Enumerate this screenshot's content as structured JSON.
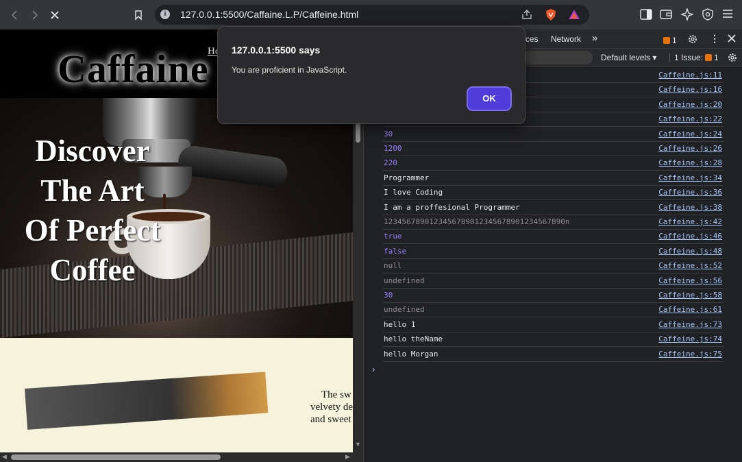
{
  "browser": {
    "url": "127.0.0.1:5500/Caffaine.L.P/Caffeine.html"
  },
  "page": {
    "logo": "Caffaine",
    "nav_home": "Ho",
    "hero_heading": "Discover The Art Of Perfect Coffee",
    "paragraph_lines": [
      "The sw",
      "velvety de",
      "and sweet"
    ]
  },
  "devtools": {
    "tab_partial": "ces",
    "tab_network": "Network",
    "more_tabs": "»",
    "issues_badge_count": "1",
    "default_levels": "Default levels ▾",
    "issues_label": "1 Issue:",
    "issues_count": "1",
    "logs": [
      {
        "msg": "",
        "src": "Caffeine.js:11",
        "kind": "white"
      },
      {
        "msg": "",
        "src": "Caffeine.js:16",
        "kind": "white"
      },
      {
        "msg": "",
        "src": "Caffeine.js:20",
        "kind": "white"
      },
      {
        "msg": "",
        "src": "Caffeine.js:22",
        "kind": "white"
      },
      {
        "msg": "30",
        "src": "Caffeine.js:24",
        "kind": "num"
      },
      {
        "msg": "1200",
        "src": "Caffeine.js:26",
        "kind": "num"
      },
      {
        "msg": "220",
        "src": "Caffeine.js:28",
        "kind": "num"
      },
      {
        "msg": "Programmer",
        "src": "Caffeine.js:34",
        "kind": "white"
      },
      {
        "msg": "I love Coding",
        "src": "Caffeine.js:36",
        "kind": "white"
      },
      {
        "msg": "I am a proffesional Programmer",
        "src": "Caffeine.js:38",
        "kind": "white"
      },
      {
        "msg": "1234567890123456789012345678901234567890n",
        "src": "Caffeine.js:42",
        "kind": "gray"
      },
      {
        "msg": "true",
        "src": "Caffeine.js:46",
        "kind": "bool"
      },
      {
        "msg": "false",
        "src": "Caffeine.js:48",
        "kind": "bool"
      },
      {
        "msg": "null",
        "src": "Caffeine.js:52",
        "kind": "gray"
      },
      {
        "msg": "undefined",
        "src": "Caffeine.js:56",
        "kind": "gray"
      },
      {
        "msg": "30",
        "src": "Caffeine.js:58",
        "kind": "num"
      },
      {
        "msg": "undefined",
        "src": "Caffeine.js:61",
        "kind": "gray"
      },
      {
        "msg": "hello 1",
        "src": "Caffeine.js:73",
        "kind": "white"
      },
      {
        "msg": "hello theName",
        "src": "Caffeine.js:74",
        "kind": "white"
      },
      {
        "msg": "hello Morgan",
        "src": "Caffeine.js:75",
        "kind": "white"
      }
    ],
    "prompt": "›"
  },
  "dialog": {
    "title": "127.0.0.1:5500 says",
    "message": "You are proficient in JavaScript.",
    "ok_label": "OK"
  },
  "colors": {
    "accent_button": "#4f3ddb",
    "log_link": "#a8c7fa",
    "log_number": "#9980ff",
    "page_background": "#f5f3dc"
  }
}
